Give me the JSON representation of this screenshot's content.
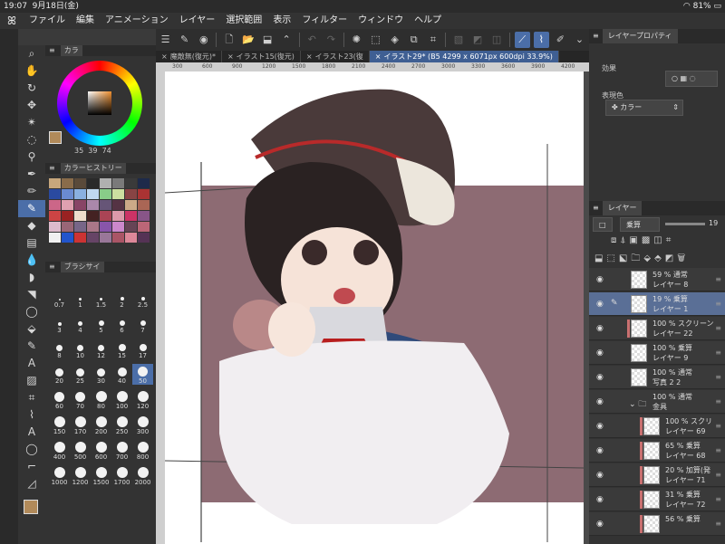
{
  "status": {
    "time": "19:07",
    "date": "9月18日(金)",
    "battery": "81%"
  },
  "menu": [
    "ファイル",
    "編集",
    "アニメーション",
    "レイヤー",
    "選択範囲",
    "表示",
    "フィルター",
    "ウィンドウ",
    "ヘルプ"
  ],
  "tabs": [
    {
      "label": "魔敵無(復元)*"
    },
    {
      "label": "イラスト15(復元)"
    },
    {
      "label": "イラスト23(復"
    },
    {
      "label": "イラスト29* (B5 4299 x 6071px 600dpi 33.9%)"
    }
  ],
  "ruler_ticks": [
    "300",
    "600",
    "900",
    "1200",
    "1500",
    "1800",
    "2100",
    "2400",
    "2700",
    "3000",
    "3300",
    "3600",
    "3900",
    "4200"
  ],
  "color_panel": {
    "title": "カラ",
    "hsv": [
      "35",
      "39",
      "74"
    ],
    "current_color": "#b18a5a"
  },
  "history_panel": {
    "title": "カラーヒストリー"
  },
  "history_colors": [
    "#c7a77c",
    "#8a6c4a",
    "#5a4a3a",
    "#2a2a2a",
    "#b0b0b0",
    "#7a7a7a",
    "#3a3a3a",
    "#1e2a4a",
    "#2a4aa0",
    "#6a8ad0",
    "#8ab0e0",
    "#c0d8f0",
    "#88cc88",
    "#cce0a0",
    "#884444",
    "#aa3333",
    "#cc6688",
    "#e0a0b0",
    "#884466",
    "#aa88aa",
    "#665577",
    "#553344",
    "#ccaa88",
    "#aa6655",
    "#cc4444",
    "#992222",
    "#eeddcc",
    "#442222",
    "#aa4455",
    "#dd99aa",
    "#cc3366",
    "#885588",
    "#ddbbcc",
    "#996677",
    "#776688",
    "#aa7788",
    "#8855aa",
    "#cc88cc",
    "#664455",
    "#bb6677",
    "#f0f0f0",
    "#2255cc",
    "#cc3333",
    "#664466",
    "#997799",
    "#aa5566",
    "#dd8899",
    "#553355"
  ],
  "brush_panel": {
    "title": "ブラシサイ"
  },
  "brush_sizes": [
    "0.7",
    "1",
    "1.5",
    "2",
    "2.5",
    "3",
    "4",
    "5",
    "6",
    "7",
    "8",
    "10",
    "12",
    "15",
    "17",
    "20",
    "25",
    "30",
    "40",
    "50",
    "60",
    "70",
    "80",
    "100",
    "120",
    "150",
    "170",
    "200",
    "250",
    "300",
    "400",
    "500",
    "600",
    "700",
    "800",
    "1000",
    "1200",
    "1500",
    "1700",
    "2000"
  ],
  "right": {
    "prop_tab": "レイヤープロパティ",
    "effect_label": "効果",
    "expr_label": "表現色",
    "expr_value": "カラー",
    "layer_tab": "レイヤー",
    "blend_mode": "乗算",
    "opacity": "19"
  },
  "layers": [
    {
      "pct": "59 % 通常",
      "name": "レイヤー 8",
      "indent": 0,
      "sel": false,
      "mask": false
    },
    {
      "pct": "19 % 乗算",
      "name": "レイヤー 1",
      "indent": 0,
      "sel": true,
      "mask": false
    },
    {
      "pct": "100 % スクリーン",
      "name": "レイヤー 22",
      "indent": 0,
      "sel": false,
      "mask": true
    },
    {
      "pct": "100 % 乗算",
      "name": "レイヤー 9",
      "indent": 0,
      "sel": false,
      "mask": false
    },
    {
      "pct": "100 % 通常",
      "name": "写真 2 2",
      "indent": 0,
      "sel": false,
      "mask": false
    },
    {
      "pct": "100 % 通常",
      "name": "金具",
      "indent": 0,
      "sel": false,
      "mask": false,
      "folder": true
    },
    {
      "pct": "100 % スクリ",
      "name": "レイヤー 69",
      "indent": 1,
      "sel": false,
      "mask": true
    },
    {
      "pct": "65 % 乗算",
      "name": "レイヤー 68",
      "indent": 1,
      "sel": false,
      "mask": true
    },
    {
      "pct": "20 % 加算(発",
      "name": "レイヤー 71",
      "indent": 1,
      "sel": false,
      "mask": true
    },
    {
      "pct": "31 % 乗算",
      "name": "レイヤー 72",
      "indent": 1,
      "sel": false,
      "mask": true
    },
    {
      "pct": "56 % 乗算",
      "name": "",
      "indent": 1,
      "sel": false,
      "mask": true
    }
  ]
}
